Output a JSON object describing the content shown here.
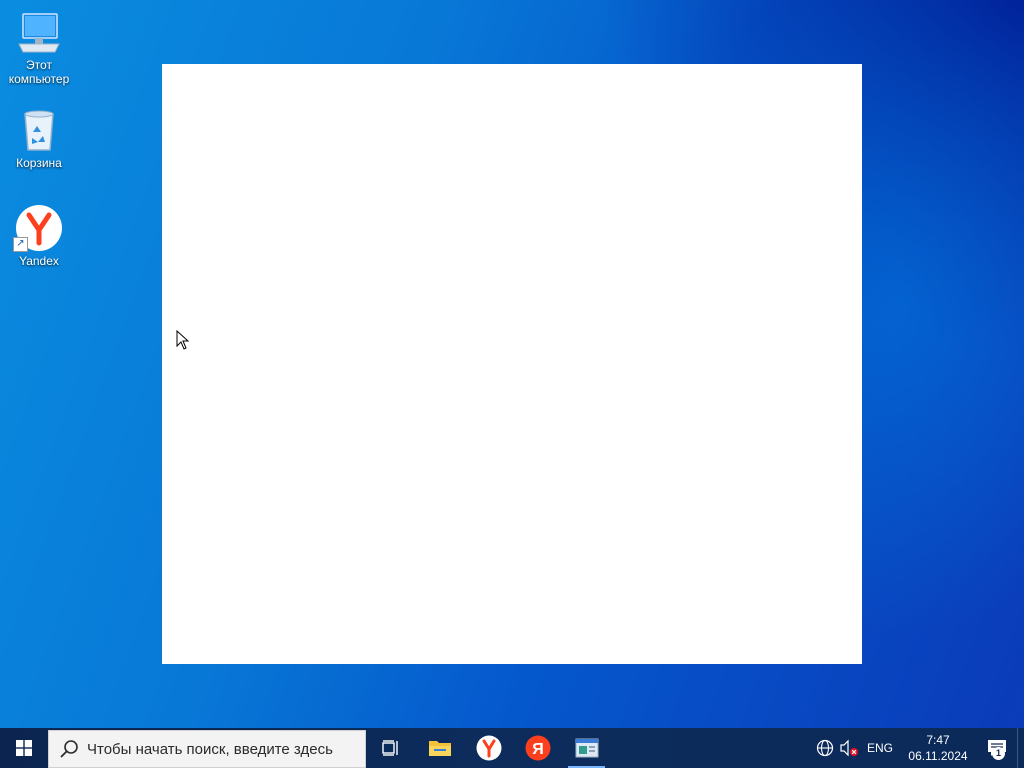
{
  "desktop": {
    "icons": [
      {
        "label_line1": "Этот",
        "label_line2": "компьютер",
        "icon": "this-pc-icon"
      },
      {
        "label": "Корзина",
        "icon": "recycle-bin-icon"
      },
      {
        "label": "Yandex",
        "icon": "yandex-browser-icon"
      }
    ]
  },
  "taskbar": {
    "start_icon": "windows-logo-icon",
    "search_placeholder": "Чтобы начать поиск, введите здесь",
    "pinned": [
      {
        "name": "task-view",
        "icon": "task-view-icon"
      },
      {
        "name": "file-explorer",
        "icon": "folder-icon"
      },
      {
        "name": "yandex-browser",
        "icon": "yandex-browser-icon"
      },
      {
        "name": "yandex",
        "icon": "yandex-ya-icon"
      },
      {
        "name": "open-app",
        "icon": "app-window-icon",
        "active": true
      }
    ],
    "tray": {
      "language": "ENG",
      "time": "7:47",
      "date": "06.11.2024",
      "notification_count": "1"
    }
  },
  "colors": {
    "taskbar_bg": "#0b2550",
    "yandex_red": "#fc3f1d",
    "folder_yellow": "#f3c13a"
  }
}
